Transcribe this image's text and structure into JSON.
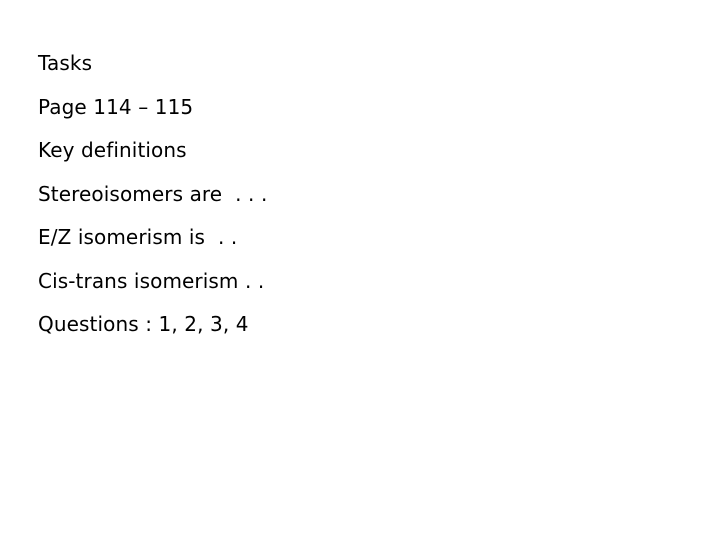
{
  "slide": {
    "background_color": "#ffffff",
    "text_color": "#000000",
    "title": "Tasks",
    "lines": [
      {
        "id": "title",
        "text": "Tasks"
      },
      {
        "id": "page-reference",
        "text": "Page 114 – 115"
      },
      {
        "id": "key-definitions",
        "text": "Key definitions"
      },
      {
        "id": "stereoisomers",
        "text": "Stereoisomers are  . . ."
      },
      {
        "id": "ez-isomerism",
        "text": "E/Z isomerism is  . ."
      },
      {
        "id": "cis-trans-isomerism",
        "text": "Cis-trans isomerism . ."
      },
      {
        "id": "questions",
        "text": "Questions : 1, 2, 3, 4"
      }
    ]
  }
}
